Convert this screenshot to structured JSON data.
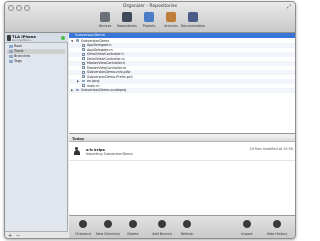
{
  "window": {
    "title": "Organizer - Repositories",
    "traffic_colors": [
      "#dcdcdc",
      "#dcdcdc",
      "#dcdcdc"
    ]
  },
  "toolbar": {
    "items": [
      {
        "label": "Devices",
        "icon": "devices-icon",
        "color": "#6a6f78"
      },
      {
        "label": "Repositories",
        "icon": "repositories-icon",
        "color": "#3f4a5a"
      },
      {
        "label": "Projects",
        "icon": "projects-icon",
        "color": "#4a7cc7"
      },
      {
        "label": "Archives",
        "icon": "archives-icon",
        "color": "#c07d3a"
      },
      {
        "label": "Documentation",
        "icon": "documentation-icon",
        "color": "#4b5d86"
      }
    ]
  },
  "sidebar": {
    "repo": {
      "title": "TLA iPhone",
      "subtitle": "svn://softcus..."
    },
    "items": [
      {
        "label": "Root",
        "selected": false
      },
      {
        "label": "Trunk",
        "selected": true
      },
      {
        "label": "Branches",
        "selected": false
      },
      {
        "label": "Tags",
        "selected": false
      }
    ],
    "add_label": "+",
    "remove_label": "−"
  },
  "tree": {
    "header": "SubversionDemo",
    "rows": [
      {
        "name": "SubversionDemo",
        "type": "folder",
        "level": 1,
        "expanded": true
      },
      {
        "name": "AppDelegate.h",
        "type": "file",
        "level": 2
      },
      {
        "name": "AppDelegate.m",
        "type": "file",
        "level": 2
      },
      {
        "name": "DetailViewController.h",
        "type": "file",
        "level": 2
      },
      {
        "name": "DetailViewController.m",
        "type": "file",
        "level": 2
      },
      {
        "name": "MasterViewController.h",
        "type": "file",
        "level": 2
      },
      {
        "name": "MasterViewController.m",
        "type": "file",
        "level": 2
      },
      {
        "name": "SubversionDemo-Info.plist",
        "type": "file",
        "level": 2
      },
      {
        "name": "SubversionDemo-Prefix.pch",
        "type": "file",
        "level": 2
      },
      {
        "name": "en.lproj",
        "type": "folder",
        "level": 2,
        "expanded": false
      },
      {
        "name": "main.m",
        "type": "file",
        "level": 2
      },
      {
        "name": "SubversionDemo.xcodeproj",
        "type": "folder",
        "level": 1,
        "expanded": false
      }
    ]
  },
  "history": {
    "header": "Today",
    "commits": [
      {
        "author": "a-b krips",
        "message": "Importing SubversionDemo",
        "meta": "26 files modified at 15:56"
      }
    ]
  },
  "bottombar": {
    "items": [
      {
        "label": "Checkout",
        "icon": "checkout-icon"
      },
      {
        "label": "New Directory",
        "icon": "new-directory-icon"
      },
      {
        "label": "Delete",
        "icon": "delete-icon"
      },
      {
        "label": "Add Branch",
        "icon": "add-branch-icon"
      },
      {
        "label": "Refresh",
        "icon": "refresh-icon"
      },
      {
        "label": "Import",
        "icon": "import-icon"
      },
      {
        "label": "Hide History",
        "icon": "hide-history-icon"
      }
    ]
  }
}
